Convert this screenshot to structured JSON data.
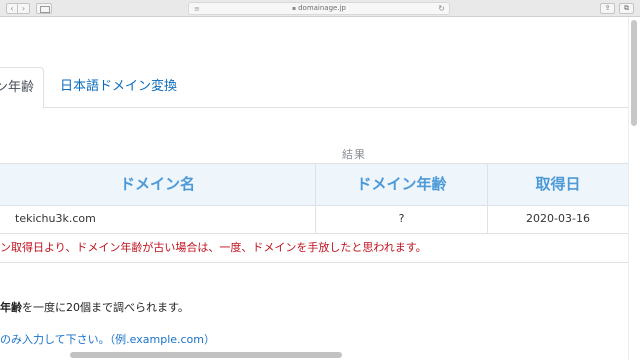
{
  "browser": {
    "address": "domainage.jp",
    "back_icon": "‹",
    "forward_icon": "›",
    "reload_icon": "↻",
    "share_icon": "⇪",
    "tabs_icon": "⧉"
  },
  "tabs": {
    "active_label": "ン年齢",
    "link_label": "日本語ドメイン変換"
  },
  "results": {
    "caption": "結果",
    "headers": [
      "ドメイン名",
      "ドメイン年齢",
      "取得日"
    ],
    "row": [
      "tekichu3k.com",
      "?",
      "2020-03-16"
    ],
    "notice": "ン取得日より、ドメイン年齢が古い場合は、一度、ドメインを手放したと思われます。"
  },
  "info": {
    "bold": "年齢",
    "rest": "を一度に20個まで調べられます。"
  },
  "hint": "のみ入力して下さい。（例.example.com）",
  "colors": {
    "header_bg": "#eef5fb",
    "header_text": "#4d9ad8",
    "link": "#0a6bbd",
    "notice": "#c1121f"
  }
}
